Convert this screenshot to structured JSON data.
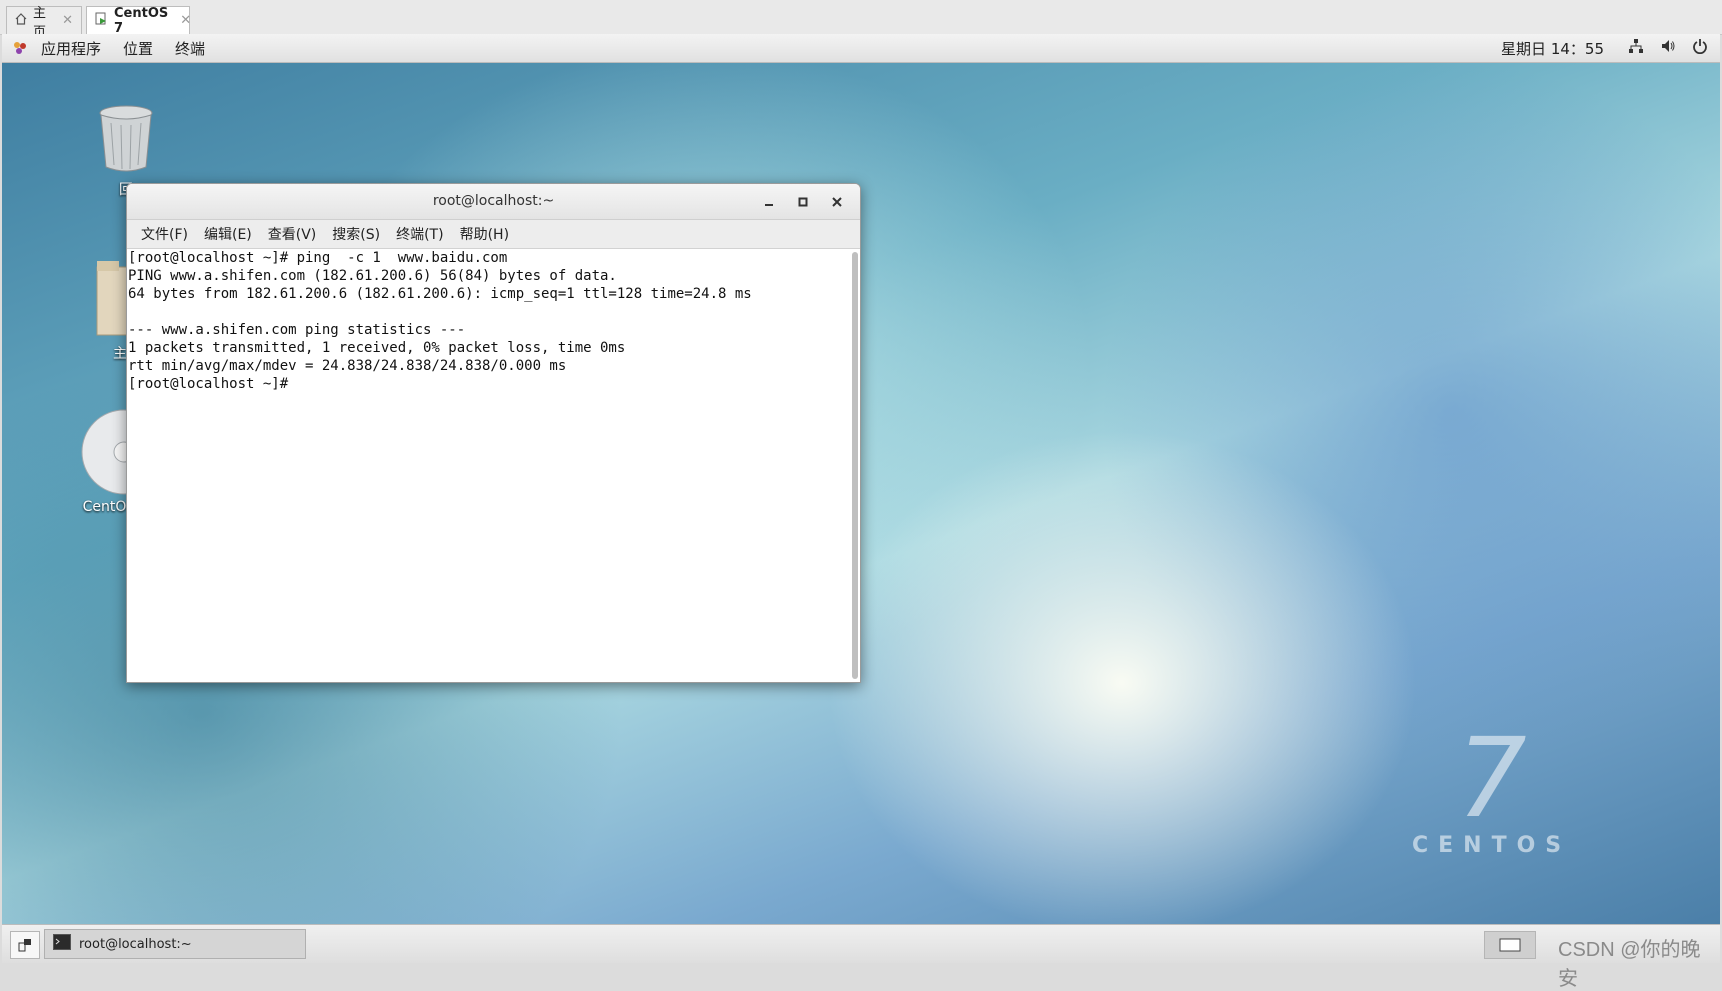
{
  "vm_tabs": [
    {
      "label": "主页",
      "icon": "home-icon"
    },
    {
      "label": "CentOS 7",
      "icon": "vm-icon"
    }
  ],
  "topbar": {
    "applications": "应用程序",
    "places": "位置",
    "terminal": "终端",
    "clock": "星期日 14：55"
  },
  "desktop": {
    "icons": [
      {
        "label": "回",
        "icon": "trash-icon"
      },
      {
        "label": "主",
        "icon": "home-folder-icon"
      },
      {
        "label": "CentOS",
        "icon": "disc-icon"
      }
    ],
    "logo_number": "7",
    "logo_text": "CENTOS"
  },
  "terminal": {
    "title": "root@localhost:~",
    "menu": [
      "文件(F)",
      "编辑(E)",
      "查看(V)",
      "搜索(S)",
      "终端(T)",
      "帮助(H)"
    ],
    "lines": [
      "[root@localhost ~]# ping  -c 1  www.baidu.com",
      "PING www.a.shifen.com (182.61.200.6) 56(84) bytes of data.",
      "64 bytes from 182.61.200.6 (182.61.200.6): icmp_seq=1 ttl=128 time=24.8 ms",
      "",
      "--- www.a.shifen.com ping statistics ---",
      "1 packets transmitted, 1 received, 0% packet loss, time 0ms",
      "rtt min/avg/max/mdev = 24.838/24.838/24.838/0.000 ms",
      "[root@localhost ~]# "
    ]
  },
  "taskbar": {
    "task_label": "root@localhost:~",
    "watermark": "CSDN @你的晚安"
  }
}
